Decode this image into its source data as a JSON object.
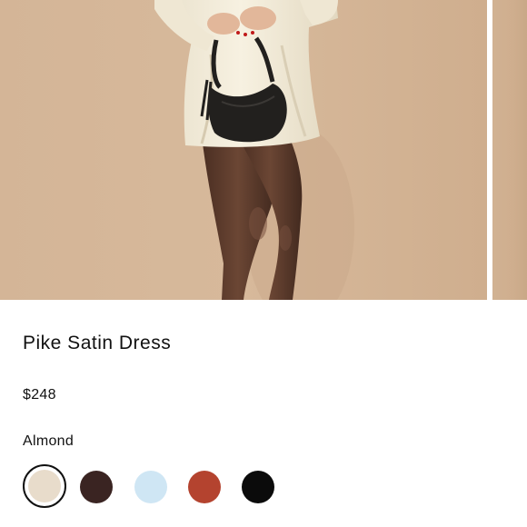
{
  "product": {
    "title": "Pike Satin Dress",
    "price": "$248",
    "selected_color": "Almond"
  },
  "swatches": [
    {
      "name": "Almond",
      "color": "#e8dccb",
      "selected": true
    },
    {
      "name": "Brown",
      "color": "#3a2422",
      "selected": false
    },
    {
      "name": "Light Blue",
      "color": "#cfe6f4",
      "selected": false
    },
    {
      "name": "Rust",
      "color": "#b4432f",
      "selected": false
    },
    {
      "name": "Black",
      "color": "#0b0b0b",
      "selected": false
    }
  ],
  "colors": {
    "photo_background": "#d5b698",
    "dress": "#f3ecd9",
    "bag": "#22201e",
    "legs": "#5a3a2c"
  }
}
